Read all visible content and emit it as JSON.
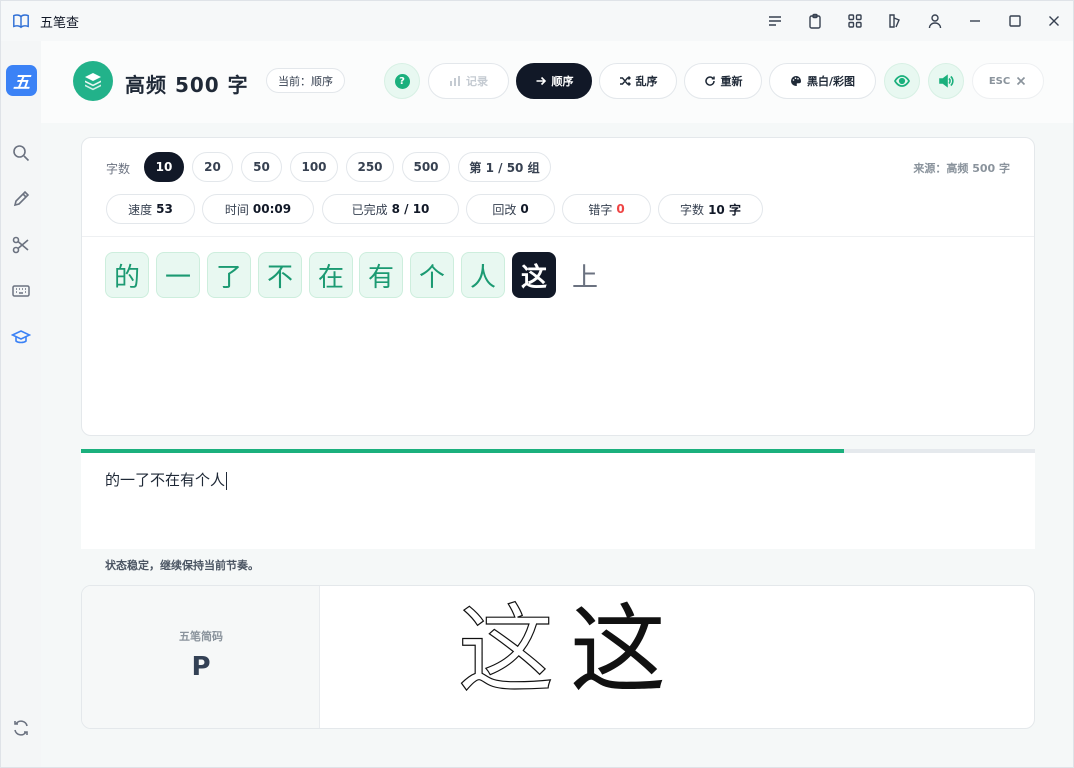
{
  "window": {
    "title": "五笔查"
  },
  "sidebar": {
    "logo_text": "五",
    "items": [
      "search",
      "edit",
      "split",
      "keyboard",
      "learn",
      "refresh"
    ]
  },
  "header": {
    "title": "高频 500 字",
    "current_mode": "当前：顺序",
    "buttons": {
      "help": "?",
      "record": "记录",
      "sequential": "顺序",
      "shuffle": "乱序",
      "restart": "重新",
      "color_mode": "黑白/彩图",
      "esc": "ESC"
    }
  },
  "practice": {
    "count_label": "字数",
    "count_options": [
      "10",
      "20",
      "50",
      "100",
      "250",
      "500"
    ],
    "selected_count": "10",
    "group": "第 1 / 50 组",
    "source": "来源：高频 500 字",
    "stats": {
      "speed_label": "速度",
      "speed_value": "53",
      "time_label": "时间",
      "time_value": "00:09",
      "completed_label": "已完成",
      "completed_value": "8 / 10",
      "backspace_label": "回改",
      "backspace_value": "0",
      "errors_label": "错字",
      "errors_value": "0",
      "chars_label": "字数",
      "chars_value": "10 字"
    },
    "characters": [
      {
        "char": "的",
        "state": "done"
      },
      {
        "char": "一",
        "state": "done"
      },
      {
        "char": "了",
        "state": "done"
      },
      {
        "char": "不",
        "state": "done"
      },
      {
        "char": "在",
        "state": "done"
      },
      {
        "char": "有",
        "state": "done"
      },
      {
        "char": "个",
        "state": "done"
      },
      {
        "char": "人",
        "state": "done"
      },
      {
        "char": "这",
        "state": "current"
      },
      {
        "char": "上",
        "state": "pending"
      }
    ],
    "progress": 0.8,
    "typed_text": "的一了不在有个人",
    "status_message": "状态稳定，继续保持当前节奏。"
  },
  "hint": {
    "label": "五笔简码",
    "code": "P",
    "glyph_outline": "这",
    "glyph_solid": "这"
  },
  "colors": {
    "accent_green": "#1bb07d",
    "dark": "#111827",
    "sidebar_blue": "#3b82f6",
    "error_red": "#ef4444"
  }
}
